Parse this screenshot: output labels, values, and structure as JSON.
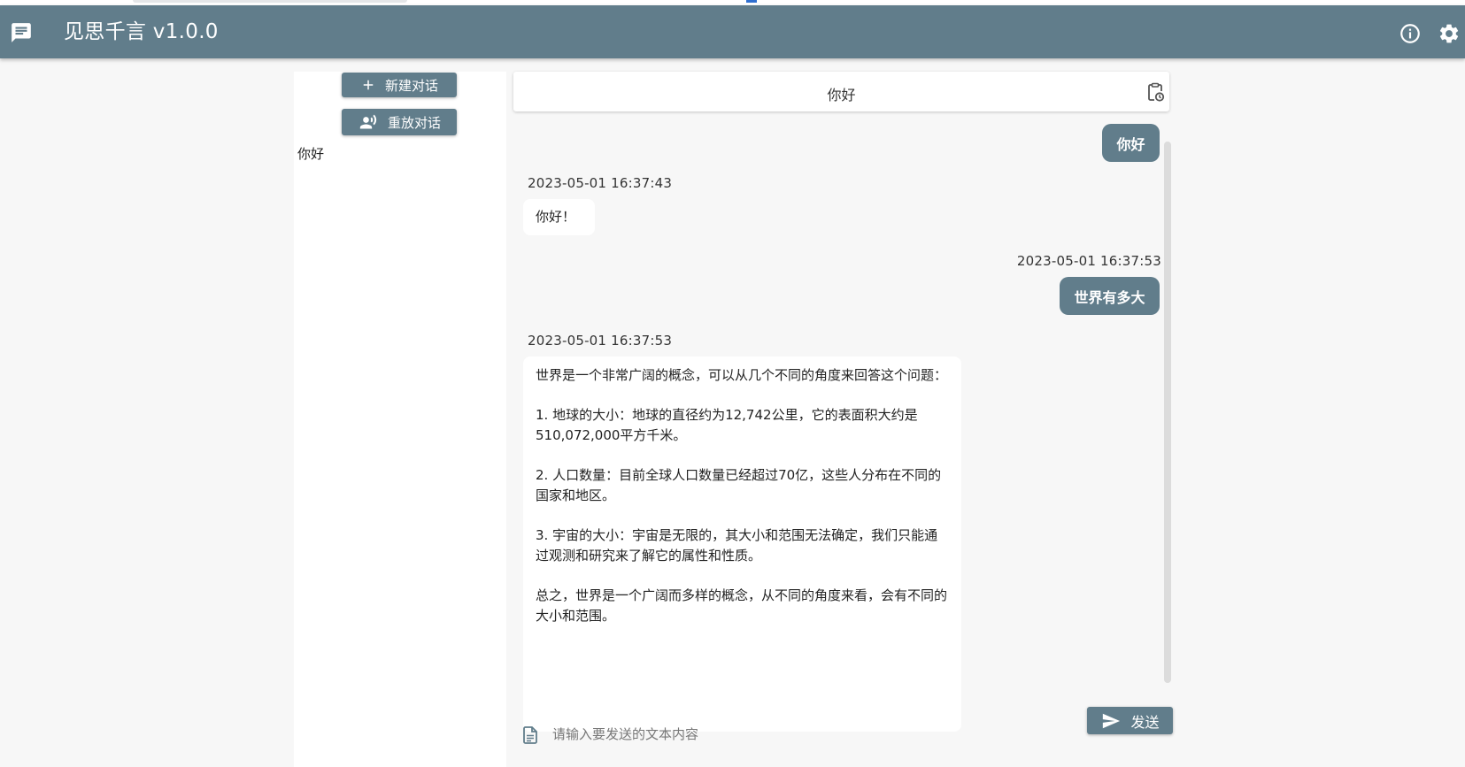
{
  "app": {
    "title": "见思千言 v1.0.0",
    "accent_color": "#617d8b",
    "icons": {
      "menu": "chat-bubble-icon",
      "info": "info-icon",
      "settings": "gear-icon"
    }
  },
  "sidebar": {
    "new_chat_label": "新建对话",
    "replay_chat_label": "重放对话",
    "conversations": [
      "你好"
    ]
  },
  "chat": {
    "title": "你好",
    "messages": [
      {
        "role": "user",
        "text": "你好"
      },
      {
        "role": "assistant",
        "time": "2023-05-01 16:37:43",
        "text": "你好！"
      },
      {
        "role": "user",
        "time": "2023-05-01 16:37:53",
        "text": "世界有多大"
      },
      {
        "role": "assistant",
        "time": "2023-05-01 16:37:53",
        "paragraphs": [
          "世界是一个非常广阔的概念，可以从几个不同的角度来回答这个问题：",
          "1. 地球的大小：地球的直径约为12,742公里，它的表面积大约是510,072,000平方千米。",
          "2. 人口数量：目前全球人口数量已经超过70亿，这些人分布在不同的国家和地区。",
          "3. 宇宙的大小：宇宙是无限的，其大小和范围无法确定，我们只能通过观测和研究来了解它的属性和性质。",
          "总之，世界是一个广阔而多样的概念，从不同的角度来看，会有不同的大小和范围。"
        ]
      }
    ]
  },
  "input": {
    "placeholder": "请输入要发送的文本内容",
    "value": "",
    "send_label": "发送"
  }
}
